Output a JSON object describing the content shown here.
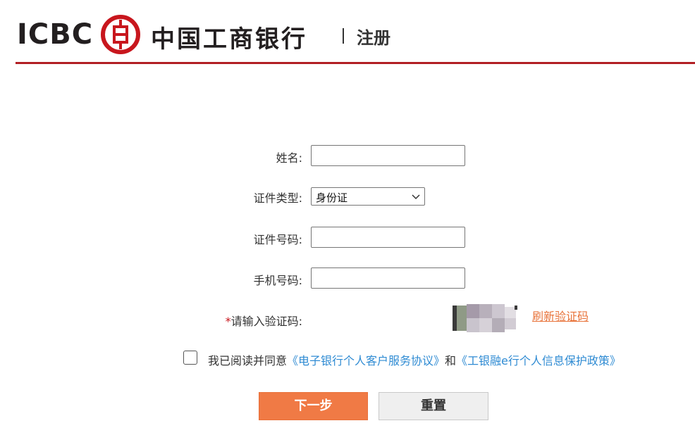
{
  "header": {
    "logo_text": "ICBC",
    "bank_name": "中国工商银行",
    "subtitle": "注册",
    "emblem_icon": "icbc-emblem-icon"
  },
  "form": {
    "name_label": "姓名:",
    "id_type_label": "证件类型:",
    "id_type_value": "身份证",
    "id_number_label": "证件号码:",
    "phone_label": "手机号码:",
    "captcha_required_mark": "*",
    "captcha_label": "请输入验证码:",
    "refresh_captcha": "刷新验证码",
    "name_value": "",
    "id_number_value": "",
    "phone_value": ""
  },
  "agreement": {
    "prefix": "我已阅读并同意",
    "link1": "《电子银行个人客户服务协议》",
    "conjunction": "和",
    "link2": "《工银融e行个人信息保护政策》",
    "checked": false
  },
  "buttons": {
    "next": "下一步",
    "reset": "重置"
  },
  "colors": {
    "brand_red": "#b21f24",
    "primary_button": "#f07a45",
    "link_blue": "#2f8bd3",
    "refresh_link": "#e8733a"
  }
}
